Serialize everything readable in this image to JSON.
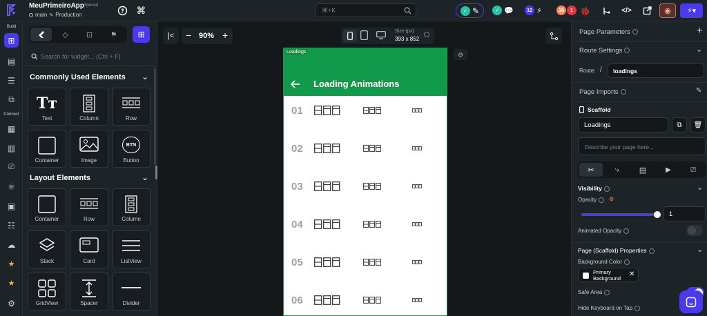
{
  "app": {
    "name": "MeuPrimeiroApp",
    "sync_status": "Synced",
    "branch": "main",
    "environment": "Production"
  },
  "topbar": {
    "search_shortcut": "⌘+K",
    "badge_12": "12",
    "badge_16": "16",
    "badge_1": "1"
  },
  "rail": {
    "build_label": "Build",
    "connect_label": "Connect"
  },
  "widgets": {
    "search_placeholder": "Search for widget... (Ctrl + F)",
    "sections": [
      {
        "title": "Commonly Used Elements",
        "items": [
          "Text",
          "Column",
          "Row",
          "Container",
          "Image",
          "Button"
        ]
      },
      {
        "title": "Layout Elements",
        "items": [
          "Container",
          "Row",
          "Column",
          "Stack",
          "Card",
          "ListView",
          "GridView",
          "Spacer",
          "Divider"
        ]
      }
    ],
    "btn_icon_text": "BTN"
  },
  "canvas": {
    "zoom": "90%",
    "size_label": "Size (px)",
    "size_value": "393 x 852",
    "page_tag": "Loadings",
    "appbar_title": "Loading Animations",
    "rows": [
      "01",
      "02",
      "03",
      "04",
      "05",
      "06"
    ]
  },
  "props": {
    "page_parameters": "Page Parameters",
    "route_settings": "Route Settings",
    "route_label": "Route:",
    "route_slash": "/",
    "route_value": "loadings",
    "page_imports": "Page Imports",
    "scaffold": "Scaffold",
    "page_name": "Loadings",
    "description_placeholder": "Describe your page here...",
    "visibility": "Visibility",
    "opacity": "Opacity",
    "opacity_value": 1,
    "opacity_display": "1",
    "animated_opacity": "Animated Opacity",
    "scaffold_properties": "Page (Scaffold) Properties",
    "background_color": "Background Color",
    "bg_color_value": "Primary Background",
    "safe_area": "Safe Area",
    "hide_keyboard": "Hide Keyboard on Tap"
  },
  "colors": {
    "accent": "#4b39ef",
    "appbar_green": "#119a4b",
    "panel": "#1d2428",
    "canvas": "#14181b"
  }
}
